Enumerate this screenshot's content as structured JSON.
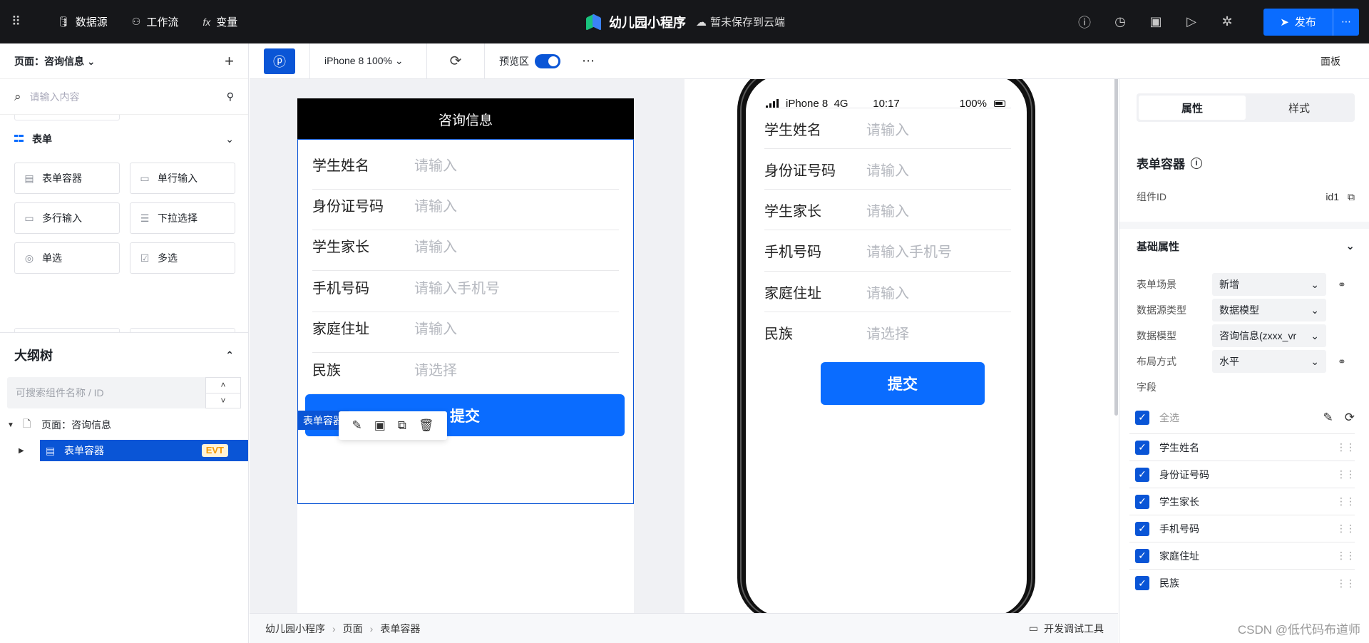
{
  "topbar": {
    "menu": [
      {
        "icon": "database-icon",
        "label": "数据源"
      },
      {
        "icon": "workflow-icon",
        "label": "工作流"
      },
      {
        "icon": "fx-icon",
        "label": "变量"
      }
    ],
    "app_title": "幼儿园小程序",
    "save_status": "暂未保存到云端",
    "publish_label": "发布"
  },
  "left": {
    "page_selector": "页面：咨询信息",
    "search_placeholder": "请输入内容",
    "group_title": "表单",
    "components": [
      "表单容器",
      "单行输入",
      "多行输入",
      "下拉选择",
      "单选",
      "多选"
    ],
    "outline_title": "大纲树",
    "outline_search_placeholder": "可搜索组件名称 / ID",
    "tree_page": "页面：咨询信息",
    "tree_selected": "表单容器",
    "evt_badge": "EVT"
  },
  "canvas_toolbar": {
    "device": "iPhone 8 100%",
    "preview_label": "预览区",
    "panel_label": "面板"
  },
  "editor": {
    "nav_title": "咨询信息",
    "fields": [
      {
        "label": "学生姓名",
        "placeholder": "请输入"
      },
      {
        "label": "身份证号码",
        "placeholder": "请输入"
      },
      {
        "label": "学生家长",
        "placeholder": "请输入"
      },
      {
        "label": "手机号码",
        "placeholder": "请输入手机号"
      },
      {
        "label": "家庭住址",
        "placeholder": "请输入"
      },
      {
        "label": "民族",
        "placeholder": "请选择"
      }
    ],
    "submit_label": "提交",
    "selection_tag": "表单容器"
  },
  "phone": {
    "carrier": "iPhone 8",
    "network": "4G",
    "time": "10:17",
    "battery": "100%",
    "fields": [
      {
        "label": "学生姓名",
        "placeholder": "请输入"
      },
      {
        "label": "身份证号码",
        "placeholder": "请输入"
      },
      {
        "label": "学生家长",
        "placeholder": "请输入"
      },
      {
        "label": "手机号码",
        "placeholder": "请输入手机号"
      },
      {
        "label": "家庭住址",
        "placeholder": "请输入"
      },
      {
        "label": "民族",
        "placeholder": "请选择"
      }
    ],
    "submit_label": "提交"
  },
  "bottombar": {
    "breadcrumb": [
      "幼儿园小程序",
      "页面",
      "表单容器"
    ],
    "devtools_label": "开发调试工具"
  },
  "right": {
    "tabs": [
      "属性",
      "样式"
    ],
    "component_title": "表单容器",
    "component_id_label": "组件ID",
    "component_id_value": "id1",
    "section_title": "基础属性",
    "props": [
      {
        "label": "表单场景",
        "value": "新增"
      },
      {
        "label": "数据源类型",
        "value": "数据模型"
      },
      {
        "label": "数据模型",
        "value": "咨询信息(zxxx_vr"
      },
      {
        "label": "布局方式",
        "value": "水平"
      }
    ],
    "fields_label": "字段",
    "select_all_label": "全选",
    "field_items": [
      "学生姓名",
      "身份证号码",
      "学生家长",
      "手机号码",
      "家庭住址",
      "民族"
    ]
  },
  "watermark": "CSDN @低代码布道师",
  "colors": {
    "accent": "#0a6cff",
    "dark_accent": "#0a55d6",
    "topbar": "#16171a"
  }
}
